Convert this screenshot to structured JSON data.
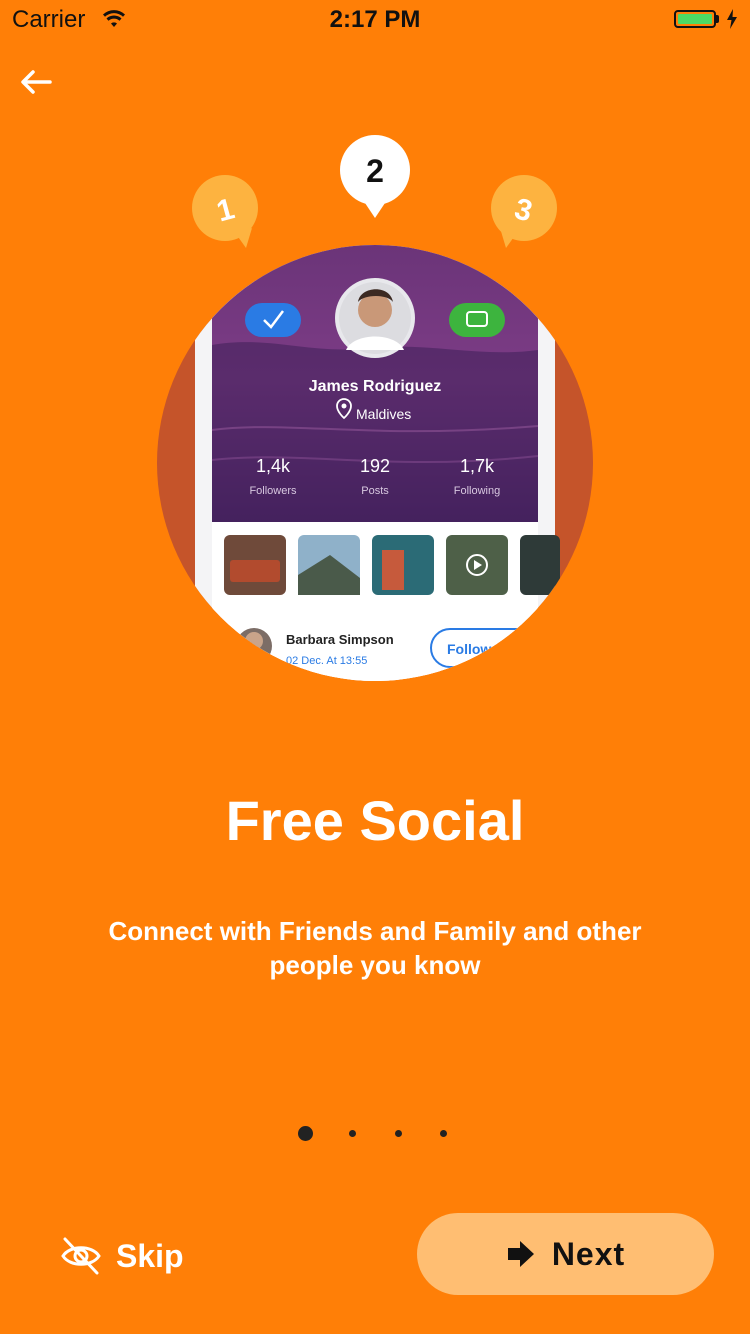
{
  "status_bar": {
    "carrier": "Carrier",
    "time": "2:17 PM"
  },
  "illustration": {
    "bubbles": [
      "1",
      "2",
      "3"
    ],
    "profile": {
      "name": "James Rodriguez",
      "location": "Maldives",
      "stats": [
        {
          "value": "1,4k",
          "label": "Followers"
        },
        {
          "value": "192",
          "label": "Posts"
        },
        {
          "value": "1,7k",
          "label": "Following"
        }
      ],
      "post_author": "Barbara Simpson",
      "post_date": "02 Dec. At 13:55",
      "follow_label": "Follow"
    }
  },
  "onboarding": {
    "title": "Free Social",
    "subtitle": "Connect with Friends and Family and other people you know"
  },
  "pagination": {
    "total": 4,
    "active": 0
  },
  "actions": {
    "skip_label": "Skip",
    "next_label": "Next"
  },
  "colors": {
    "background": "#FF7F07",
    "next_button": "#FFBE72",
    "bubble": "#FDB340"
  }
}
